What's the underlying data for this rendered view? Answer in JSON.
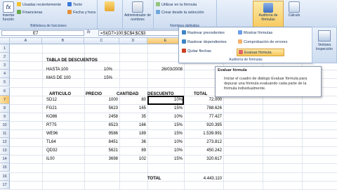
{
  "ribbon": {
    "insert_function": "Insertar función",
    "group_library": "Biblioteca de funciones",
    "recent": "Usadas recientemente",
    "financial": "Financieras",
    "text": "Texto",
    "datetime": "Fecha y hora",
    "name_manager": "Administrador de nombres",
    "use_in_formula": "Utilizar en la fórmula",
    "create_from_selection": "Crear desde la selección",
    "group_names": "Nombres definidos",
    "audit": "Auditoría de fórmulas",
    "calc": "Cálculo",
    "colors": {
      "accent": "#f7c95d",
      "ribbon_bg": "#cddcf0"
    }
  },
  "formula_bar": {
    "name_box": "E7",
    "fx": "fx",
    "formula": "=SI(D7>100;$C$4;$C$3"
  },
  "columns": [
    "A",
    "B",
    "C",
    "D",
    "E",
    "F",
    "G",
    "H",
    "I"
  ],
  "rows": [
    "1",
    "2",
    "3",
    "4",
    "5",
    "6",
    "7",
    "8",
    "9",
    "10",
    "11",
    "12",
    "13",
    "14",
    "15",
    "16",
    "17"
  ],
  "sheet": {
    "title_tabla": "TABLA DE DESCUENTOS",
    "hasta_label": "HASTA 100",
    "hasta_val": "10%",
    "date": "26/03/2008",
    "mas_label": "MAS DE 100",
    "mas_val": "15%",
    "headers": [
      "ARTICULO",
      "PRECIO",
      "CANTIDAD",
      "DESCUENTO",
      "TOTAL"
    ],
    "data": [
      {
        "articulo": "SD12",
        "precio": "1000",
        "cantidad": "80",
        "descuento": "10%",
        "total": "72.000"
      },
      {
        "articulo": "FG21",
        "precio": "5623",
        "cantidad": "165",
        "descuento": "15%",
        "total": "788.626"
      },
      {
        "articulo": "KO86",
        "precio": "2458",
        "cantidad": "35",
        "descuento": "10%",
        "total": "77.427"
      },
      {
        "articulo": "RT75",
        "precio": "6523",
        "cantidad": "166",
        "descuento": "15%",
        "total": "920.395"
      },
      {
        "articulo": "WE96",
        "precio": "9586",
        "cantidad": "189",
        "descuento": "15%",
        "total": "1.539.991"
      },
      {
        "articulo": "TL64",
        "precio": "8451",
        "cantidad": "36",
        "descuento": "10%",
        "total": "273.812"
      },
      {
        "articulo": "QD32",
        "precio": "5621",
        "cantidad": "89",
        "descuento": "10%",
        "total": "450.242"
      },
      {
        "articulo": "IL00",
        "precio": "3698",
        "cantidad": "102",
        "descuento": "15%",
        "total": "320.617"
      }
    ],
    "total_label": "TOTAL",
    "total_value": "4.443.110"
  },
  "dropdown": {
    "trace_precedents": "Rastrear precedentes",
    "trace_dependents": "Rastrear dependientes",
    "remove_arrows": "Quitar flechas",
    "show_formulas": "Mostrar fórmulas",
    "error_check": "Comprobación de errores",
    "evaluate": "Evaluar fórmula",
    "label": "Auditoría de fórmulas",
    "watch_window": "Ventana Inspección"
  },
  "tooltip": {
    "title": "Evaluar fórmula",
    "body": "Iniciar el cuadro de diálogo Evaluar fórmula para depurar una fórmula evaluando cada parte de la fórmula individualmente."
  }
}
